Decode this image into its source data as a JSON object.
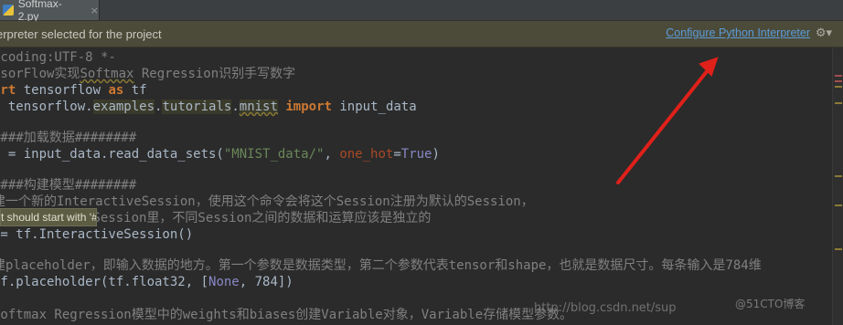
{
  "tab": {
    "filename": "Softmax-2.py",
    "close": "×"
  },
  "banner": {
    "message": "erpreter selected for the project",
    "link": "Configure Python Interpreter",
    "gear": "⚙▾"
  },
  "code": {
    "l1": " coding:UTF-8 *-",
    "l2a": "nsorFlow实现",
    "l2b": "Softmax",
    "l2c": " Regression识别手写数字",
    "l3_kw": "ort",
    "l3_mod": " tensorflow ",
    "l3_as": "as",
    "l3_tf": " tf",
    "l4_kw": "m",
    "l4_a": " tensorflow.",
    "l4_b": "examples",
    "l4_c": ".",
    "l4_d": "tutorials",
    "l4_e": ".",
    "l4_f": "mnist",
    "l4_imp": " import",
    "l4_g": " input_data",
    "l6": "####加载数据########",
    "l7a": "t = input_data.read_data_sets(",
    "l7str": "\"MNIST_data/\"",
    "l7b": ", ",
    "l7kw": "one_hot",
    "l7c": "=",
    "l7true": "True",
    "l7d": ")",
    "l9": "####构建模型########",
    "l10": "建一个新的InteractiveSession，使用这个命令会将这个Session注册为默认的Session，",
    "l11": "        在这个Session里，不同Session之间的数据和运算应该是独立的",
    "l12": " = tf.InteractiveSession()",
    "l14": "建placeholder，即输入数据的地方。第一个参数是数据类型，第二个参数代表tensor和shape，也就是数据尺寸。每条输入是784维",
    "l15a": "tf.placeholder(tf.float32, [",
    "l15b": "None",
    "l15c": ", 784])",
    "l17": "Softmax Regression模型中的weights和biases创建Variable对象，Variable存储模型参数。"
  },
  "tooltip": "t should start with '# '",
  "watermark": "http://blog.csdn.net/sup",
  "watermark2": "@51CTO博客"
}
